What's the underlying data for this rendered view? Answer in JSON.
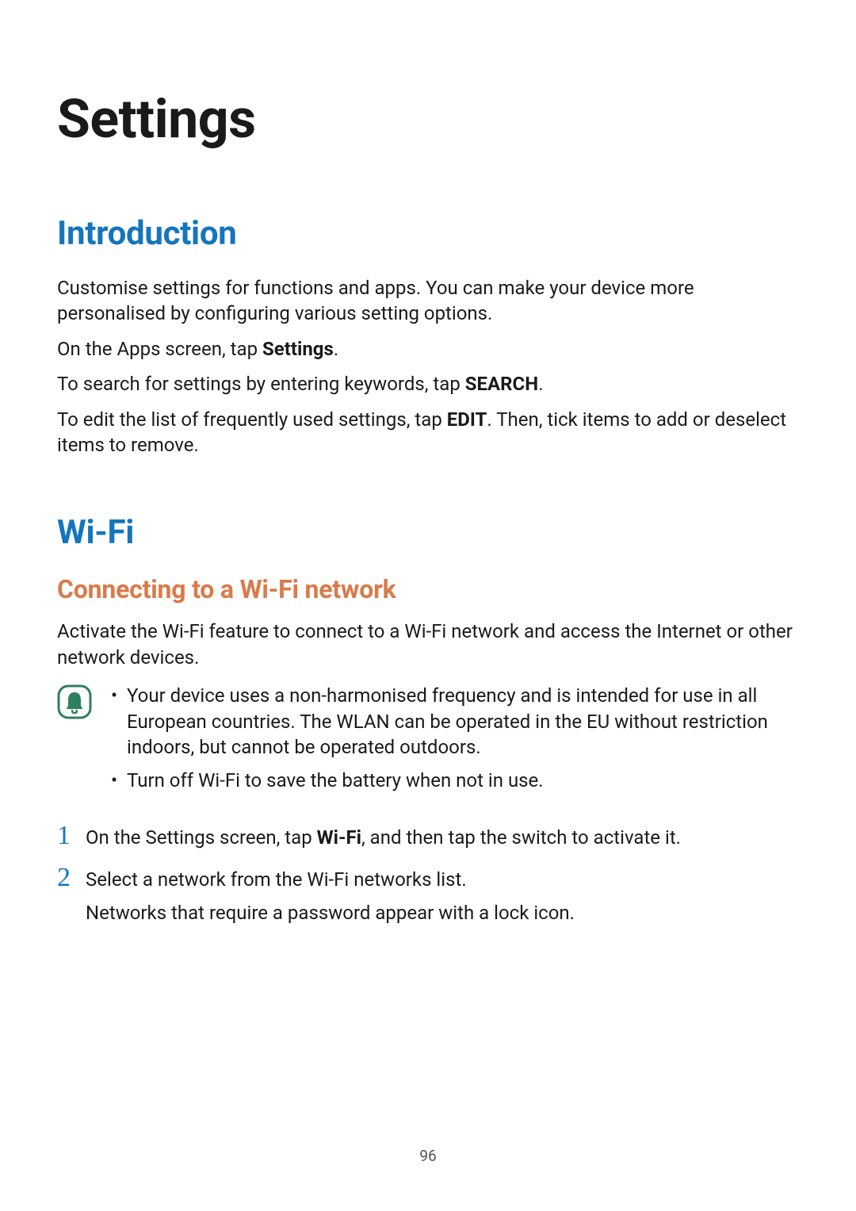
{
  "title": "Settings",
  "sections": {
    "intro": {
      "heading": "Introduction",
      "p1": "Customise settings for functions and apps. You can make your device more personalised by configuring various setting options.",
      "p2_pre": "On the Apps screen, tap ",
      "p2_bold": "Settings",
      "p2_post": ".",
      "p3_pre": "To search for settings by entering keywords, tap ",
      "p3_bold": "SEARCH",
      "p3_post": ".",
      "p4_pre": "To edit the list of frequently used settings, tap ",
      "p4_bold": "EDIT",
      "p4_post": ". Then, tick items to add or deselect items to remove."
    },
    "wifi": {
      "heading": "Wi-Fi",
      "sub_heading": "Connecting to a Wi-Fi network",
      "p1": "Activate the Wi-Fi feature to connect to a Wi-Fi network and access the Internet or other network devices.",
      "notes": {
        "bullet_dot": "•",
        "b1": "Your device uses a non-harmonised frequency and is intended for use in all European countries. The WLAN can be operated in the EU without restriction indoors, but cannot be operated outdoors.",
        "b2": "Turn off Wi-Fi to save the battery when not in use."
      },
      "steps": {
        "s1_num": "1",
        "s1_pre": "On the Settings screen, tap ",
        "s1_bold": "Wi-Fi",
        "s1_post": ", and then tap the switch to activate it.",
        "s2_num": "2",
        "s2": "Select a network from the Wi-Fi networks list.",
        "s2_sub": "Networks that require a password appear with a lock icon."
      }
    }
  },
  "page_number": "96"
}
